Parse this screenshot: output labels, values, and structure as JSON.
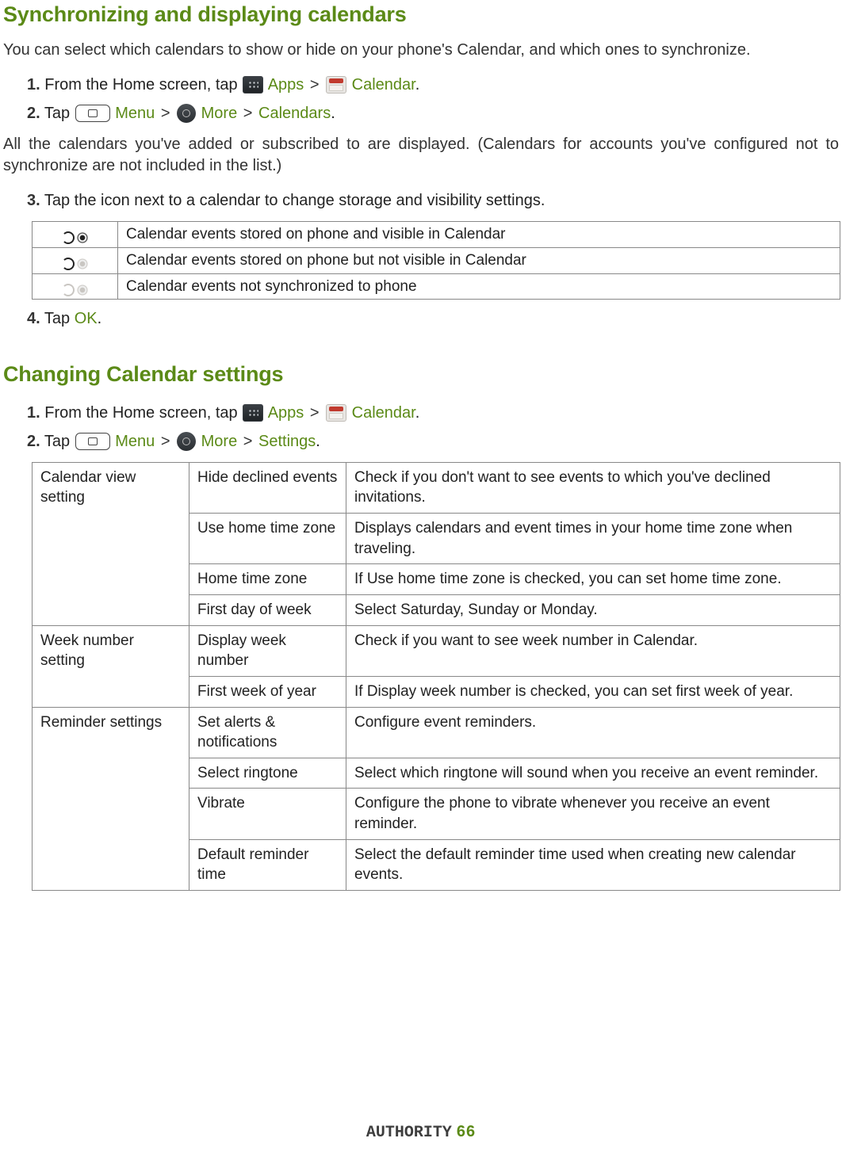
{
  "section1": {
    "heading": "Synchronizing and displaying calendars",
    "intro": "You can select which calendars to show or hide on your phone's Calendar, and which ones to synchronize.",
    "step1": {
      "num": "1.",
      "pre": " From the Home screen, tap ",
      "apps": "Apps",
      "gt": ">",
      "calendar": " Calendar",
      "dot": "."
    },
    "step2": {
      "num": "2.",
      "pre": " Tap ",
      "menu": "Menu",
      "gt1": ">",
      "more": " More",
      "gt2": ">",
      "calendars": "Calendars",
      "dot": "."
    },
    "para2": "All the calendars you've added or subscribed to are displayed. (Calendars for accounts you've configured not to synchronize are not included in the list.)",
    "step3": {
      "num": "3.",
      "text": " Tap the icon next to a calendar to change storage and visibility settings."
    },
    "statusRows": [
      "Calendar events stored on phone and visible in Calendar",
      "Calendar events stored on phone but not visible in Calendar",
      "Calendar events not synchronized to phone"
    ],
    "step4": {
      "num": "4.",
      "pre": " Tap ",
      "ok": "OK",
      "dot": "."
    }
  },
  "section2": {
    "heading": "Changing Calendar settings",
    "step1": {
      "num": "1.",
      "pre": " From the Home screen, tap ",
      "apps": "Apps",
      "gt": ">",
      "calendar": " Calendar",
      "dot": "."
    },
    "step2": {
      "num": "2.",
      "pre": " Tap ",
      "menu": "Menu",
      "gt1": ">",
      "more": " More",
      "gt2": ">",
      "settings": "Settings",
      "dot": "."
    },
    "table": {
      "g1": {
        "name": "Calendar view setting",
        "rows": [
          {
            "opt": "Hide declined events",
            "desc": "Check if you don't want to see events to which you've declined invitations."
          },
          {
            "opt": "Use home time zone",
            "desc": "Displays calendars and event times in your home time zone when traveling."
          },
          {
            "opt": "Home time zone",
            "desc": "If Use home time zone is checked, you can set home time zone."
          },
          {
            "opt": "First day of week",
            "desc": "Select Saturday, Sunday or Monday."
          }
        ]
      },
      "g2": {
        "name": "Week number setting",
        "rows": [
          {
            "opt": "Display week number",
            "desc": "Check if you want to see week number in Calendar."
          },
          {
            "opt": "First week of year",
            "desc": "If Display week number is checked, you can set first week of year."
          }
        ]
      },
      "g3": {
        "name": "Reminder settings",
        "rows": [
          {
            "opt": "Set alerts & notifications",
            "desc": "Configure event reminders."
          },
          {
            "opt": "Select ringtone",
            "desc": "Select which ringtone will sound when you receive an event reminder."
          },
          {
            "opt": "Vibrate",
            "desc": "Configure the phone to vibrate whenever you receive an event reminder."
          },
          {
            "opt": "Default reminder time",
            "desc": "Select the default reminder time used when creating new calendar events."
          }
        ]
      }
    }
  },
  "footer": {
    "brand": "AUTHORITY",
    "page": "66"
  }
}
